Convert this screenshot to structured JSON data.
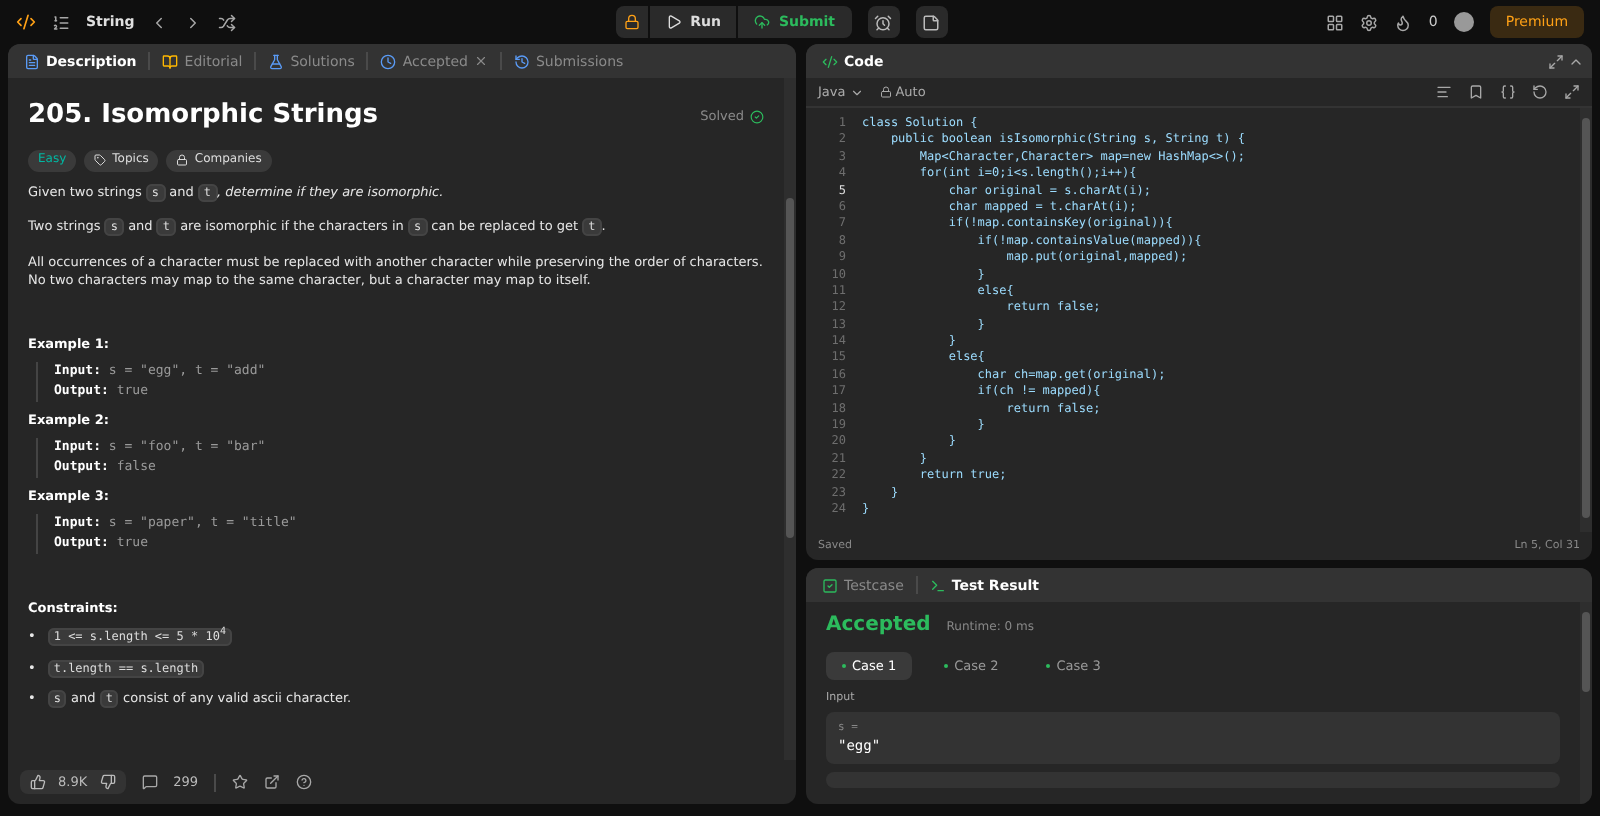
{
  "topbar": {
    "problem_list": "String",
    "run": "Run",
    "submit": "Submit",
    "streak": "0",
    "premium": "Premium"
  },
  "description_tabs": [
    {
      "label": "Description",
      "selected": true,
      "closable": false
    },
    {
      "label": "Editorial",
      "selected": false,
      "closable": false
    },
    {
      "label": "Solutions",
      "selected": false,
      "closable": false
    },
    {
      "label": "Accepted",
      "selected": false,
      "closable": true
    },
    {
      "label": "Submissions",
      "selected": false,
      "closable": false
    }
  ],
  "problem": {
    "title": "205. Isomorphic Strings",
    "status": "Solved",
    "difficulty": "Easy",
    "tags": [
      {
        "label": "Topics",
        "kind": "tag"
      },
      {
        "label": "Companies",
        "kind": "lock"
      }
    ],
    "paragraphs": [
      [
        {
          "kind": "text",
          "text": "Given two strings "
        },
        {
          "kind": "code",
          "text": "s"
        },
        {
          "kind": "text",
          "text": " and "
        },
        {
          "kind": "code",
          "text": "t"
        },
        {
          "kind": "italic",
          "text": ", determine if they are isomorphic."
        }
      ],
      [
        {
          "kind": "text",
          "text": "Two strings "
        },
        {
          "kind": "code",
          "text": "s"
        },
        {
          "kind": "text",
          "text": " and "
        },
        {
          "kind": "code",
          "text": "t"
        },
        {
          "kind": "text",
          "text": " are isomorphic if the characters in "
        },
        {
          "kind": "code",
          "text": "s"
        },
        {
          "kind": "text",
          "text": " can be replaced to get "
        },
        {
          "kind": "code",
          "text": "t"
        },
        {
          "kind": "text",
          "text": "."
        }
      ],
      [
        {
          "kind": "text",
          "text": "All occurrences of a character must be replaced with another character while preserving the order of characters. No two characters may map to the same character, but a character may map to itself."
        }
      ]
    ],
    "examples": [
      {
        "heading": "Example 1:",
        "input_label": "Input:",
        "input": "s = \"egg\", t = \"add\"",
        "output_label": "Output:",
        "output": "true"
      },
      {
        "heading": "Example 2:",
        "input_label": "Input:",
        "input": "s = \"foo\", t = \"bar\"",
        "output_label": "Output:",
        "output": "false"
      },
      {
        "heading": "Example 3:",
        "input_label": "Input:",
        "input": "s = \"paper\", t = \"title\"",
        "output_label": "Output:",
        "output": "true"
      }
    ],
    "constraints_heading": "Constraints:",
    "constraints": [
      {
        "marker": "•",
        "parts": [
          {
            "kind": "code",
            "text": "1 <= s.length <= 5 * 10$^{4}$"
          }
        ]
      },
      {
        "marker": "•",
        "parts": [
          {
            "kind": "code",
            "text": "t.length == s.length"
          }
        ]
      },
      {
        "marker": "•",
        "parts": [
          {
            "kind": "code",
            "text": "s"
          },
          {
            "kind": "text",
            "text": " and "
          },
          {
            "kind": "code",
            "text": "t"
          },
          {
            "kind": "text",
            "text": " consist of any valid ascii character."
          }
        ]
      }
    ]
  },
  "footer": {
    "likes": "8.9K",
    "comments": "299"
  },
  "code_panel": {
    "title": "Code",
    "language": "Java",
    "mode": "Auto",
    "status": "Saved",
    "cursor": "Ln 5, Col 31",
    "lines": [
      {
        "number": "1",
        "text": "class Solution {",
        "current": false
      },
      {
        "number": "2",
        "text": "    public boolean isIsomorphic(String s, String t) {",
        "current": false
      },
      {
        "number": "3",
        "text": "        Map<Character,Character> map=new HashMap<>();",
        "current": false
      },
      {
        "number": "4",
        "text": "        for(int i=0;i<s.length();i++){",
        "current": false
      },
      {
        "number": "5",
        "text": "            char original = s.charAt(i);",
        "current": true
      },
      {
        "number": "6",
        "text": "            char mapped = t.charAt(i);",
        "current": false
      },
      {
        "number": "7",
        "text": "            if(!map.containsKey(original)){",
        "current": false
      },
      {
        "number": "8",
        "text": "                if(!map.containsValue(mapped)){",
        "current": false
      },
      {
        "number": "9",
        "text": "                    map.put(original,mapped);",
        "current": false
      },
      {
        "number": "10",
        "text": "                }",
        "current": false
      },
      {
        "number": "11",
        "text": "                else{",
        "current": false
      },
      {
        "number": "12",
        "text": "                    return false;",
        "current": false
      },
      {
        "number": "13",
        "text": "                }",
        "current": false
      },
      {
        "number": "14",
        "text": "            }",
        "current": false
      },
      {
        "number": "15",
        "text": "            else{",
        "current": false
      },
      {
        "number": "16",
        "text": "                char ch=map.get(original);",
        "current": false
      },
      {
        "number": "17",
        "text": "                if(ch != mapped){",
        "current": false
      },
      {
        "number": "18",
        "text": "                    return false;",
        "current": false
      },
      {
        "number": "19",
        "text": "                }",
        "current": false
      },
      {
        "number": "20",
        "text": "            }",
        "current": false
      },
      {
        "number": "21",
        "text": "        }",
        "current": false
      },
      {
        "number": "22",
        "text": "        return true;",
        "current": false
      },
      {
        "number": "23",
        "text": "    }",
        "current": false
      },
      {
        "number": "24",
        "text": "}",
        "current": false
      }
    ]
  },
  "test_tabs": [
    {
      "label": "Testcase",
      "selected": false
    },
    {
      "label": "Test Result",
      "selected": true
    }
  ],
  "result": {
    "verdict": "Accepted",
    "runtime": "Runtime: 0 ms",
    "cases": [
      {
        "label": "Case 1",
        "selected": true
      },
      {
        "label": "Case 2",
        "selected": false
      },
      {
        "label": "Case 3",
        "selected": false
      }
    ],
    "input_label": "Input",
    "variable": "s =",
    "value": "\"egg\""
  }
}
